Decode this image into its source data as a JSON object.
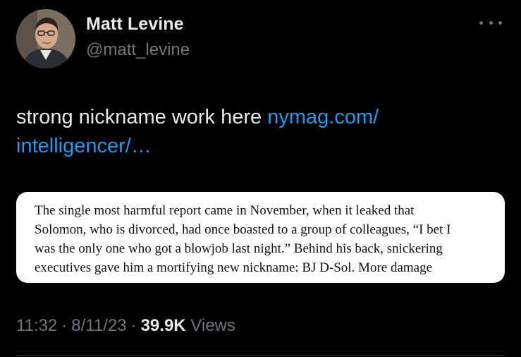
{
  "author": {
    "display_name": "Matt Levine",
    "handle": "@matt_levine"
  },
  "more_icon": "more-horizontal-icon",
  "tweet": {
    "text": "strong nickname work here ",
    "link_text": "nymag.com/​intelligencer/…"
  },
  "quote_image": {
    "lines": [
      "The single most harmful report came in November, when it leaked that",
      "Solomon, who is divorced, had once boasted to a group of colleagues, “I bet I",
      "was the only one who got a blowjob last night.” Behind his back, snickering",
      "executives gave him a mortifying new nickname: BJ D-Sol. More damage"
    ]
  },
  "meta": {
    "time": "11:32",
    "date": "8/11/23",
    "views_count": "39.9K",
    "views_label": "Views"
  },
  "colors": {
    "background": "#000000",
    "primary_text": "#e7e9ea",
    "secondary_text": "#71767b",
    "link": "#1d9bf0"
  }
}
